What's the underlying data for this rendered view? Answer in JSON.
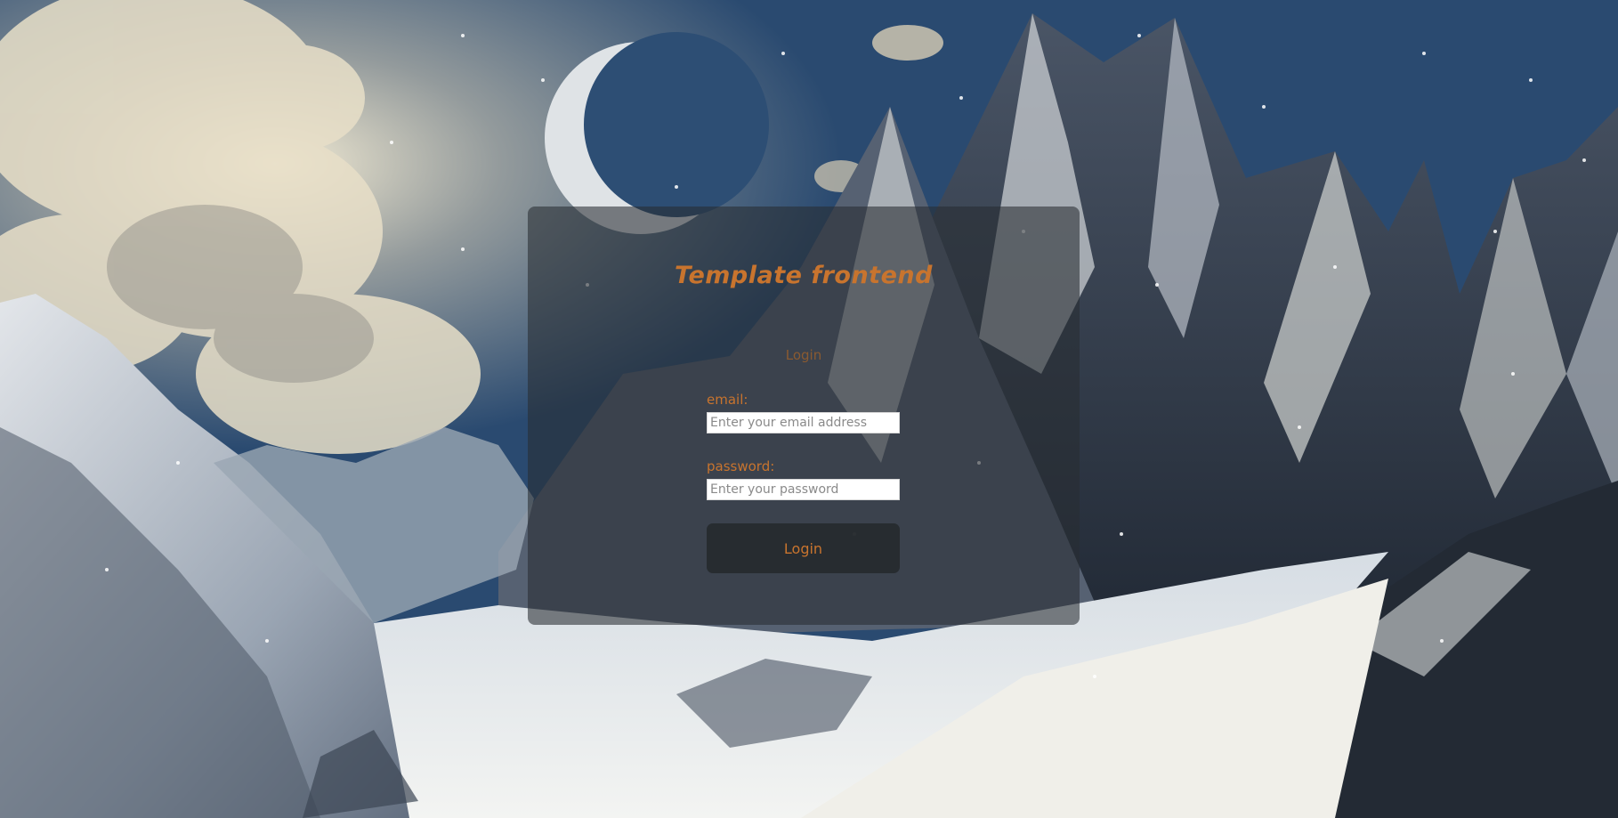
{
  "app": {
    "title": "Template frontend",
    "subtitle": "Login"
  },
  "form": {
    "email_label": "email:",
    "email_placeholder": "Enter your email address",
    "email_value": "",
    "password_label": "password:",
    "password_placeholder": "Enter your password",
    "password_value": "",
    "submit_label": "Login"
  },
  "colors": {
    "accent": "#c8742e",
    "panel": "#282d32",
    "button": "#262a2e"
  }
}
